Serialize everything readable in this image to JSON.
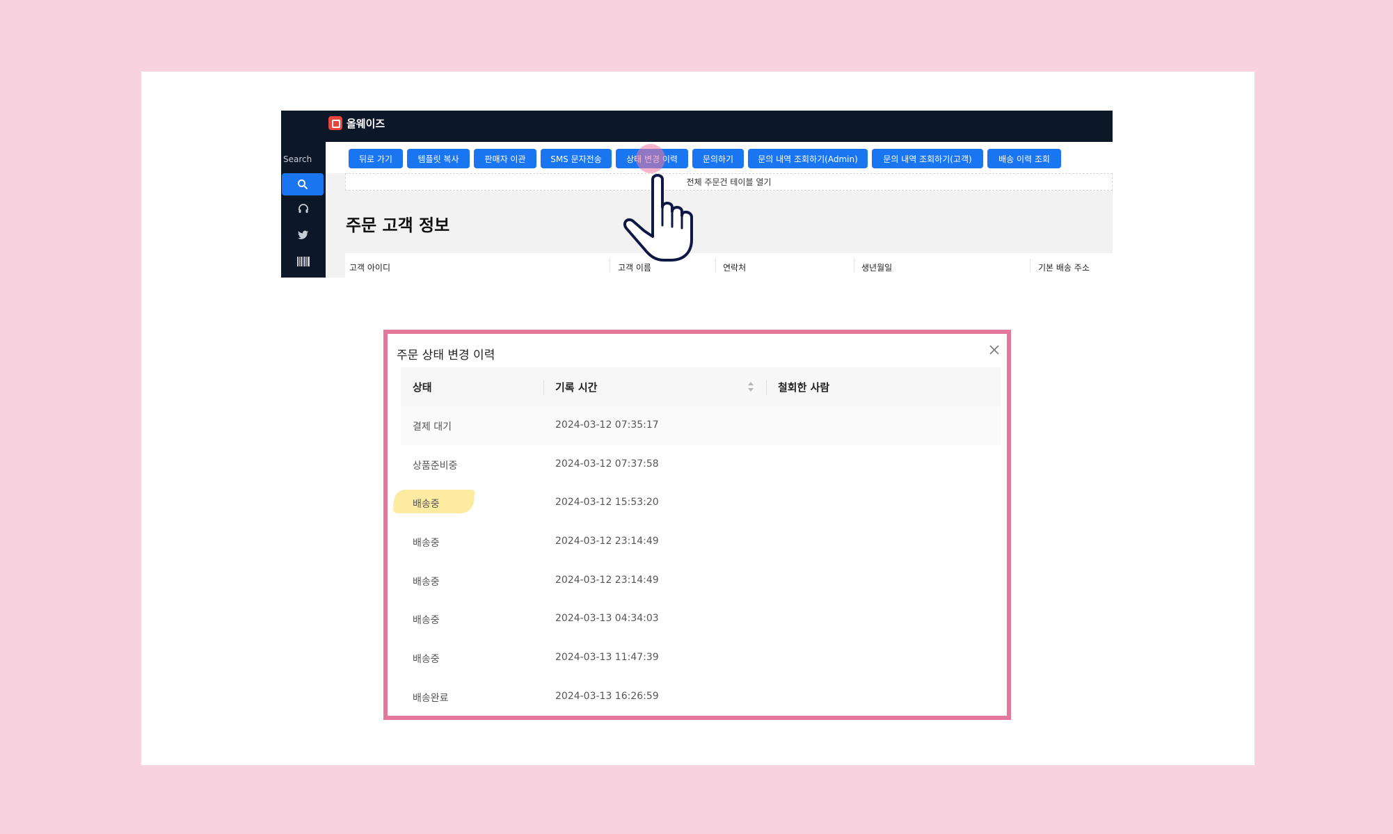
{
  "app": {
    "brand": "올웨이즈",
    "sidebar": {
      "search_label": "Search",
      "icons": [
        "search-icon",
        "headset-icon",
        "twitter-icon",
        "barcode-icon"
      ]
    },
    "action_buttons": [
      "뒤로 가기",
      "템플릿 복사",
      "판매자 이관",
      "SMS 문자전송",
      "상태 변경 이력",
      "문의하기",
      "문의 내역 조회하기(Admin)",
      "문의 내역 조회하기(고객)",
      "배송 이력 조회"
    ],
    "order_table_link": "전체 주문건 테이블 열기",
    "page_title": "주문 고객 정보",
    "customer_columns": [
      "고객 아이디",
      "고객 이름",
      "연락처",
      "생년월일",
      "기본 배송 주소"
    ]
  },
  "modal": {
    "title": "주문 상태 변경 이력",
    "columns": [
      "상태",
      "기록 시간",
      "철회한 사람"
    ],
    "rows": [
      {
        "status": "결제 대기",
        "time": "2024-03-12 07:35:17",
        "by": ""
      },
      {
        "status": "상품준비중",
        "time": "2024-03-12 07:37:58",
        "by": ""
      },
      {
        "status": "배송중",
        "time": "2024-03-12 15:53:20",
        "by": "",
        "highlighted": true
      },
      {
        "status": "배송중",
        "time": "2024-03-12 23:14:49",
        "by": ""
      },
      {
        "status": "배송중",
        "time": "2024-03-12 23:14:49",
        "by": ""
      },
      {
        "status": "배송중",
        "time": "2024-03-13 04:34:03",
        "by": ""
      },
      {
        "status": "배송중",
        "time": "2024-03-13 11:47:39",
        "by": ""
      },
      {
        "status": "배송완료",
        "time": "2024-03-13 16:26:59",
        "by": ""
      }
    ]
  },
  "colors": {
    "page_bg": "#f8d3df",
    "navy": "#0c1728",
    "button_blue": "#1a76f0",
    "modal_border": "#e3789b",
    "highlight": "#fde68a"
  }
}
